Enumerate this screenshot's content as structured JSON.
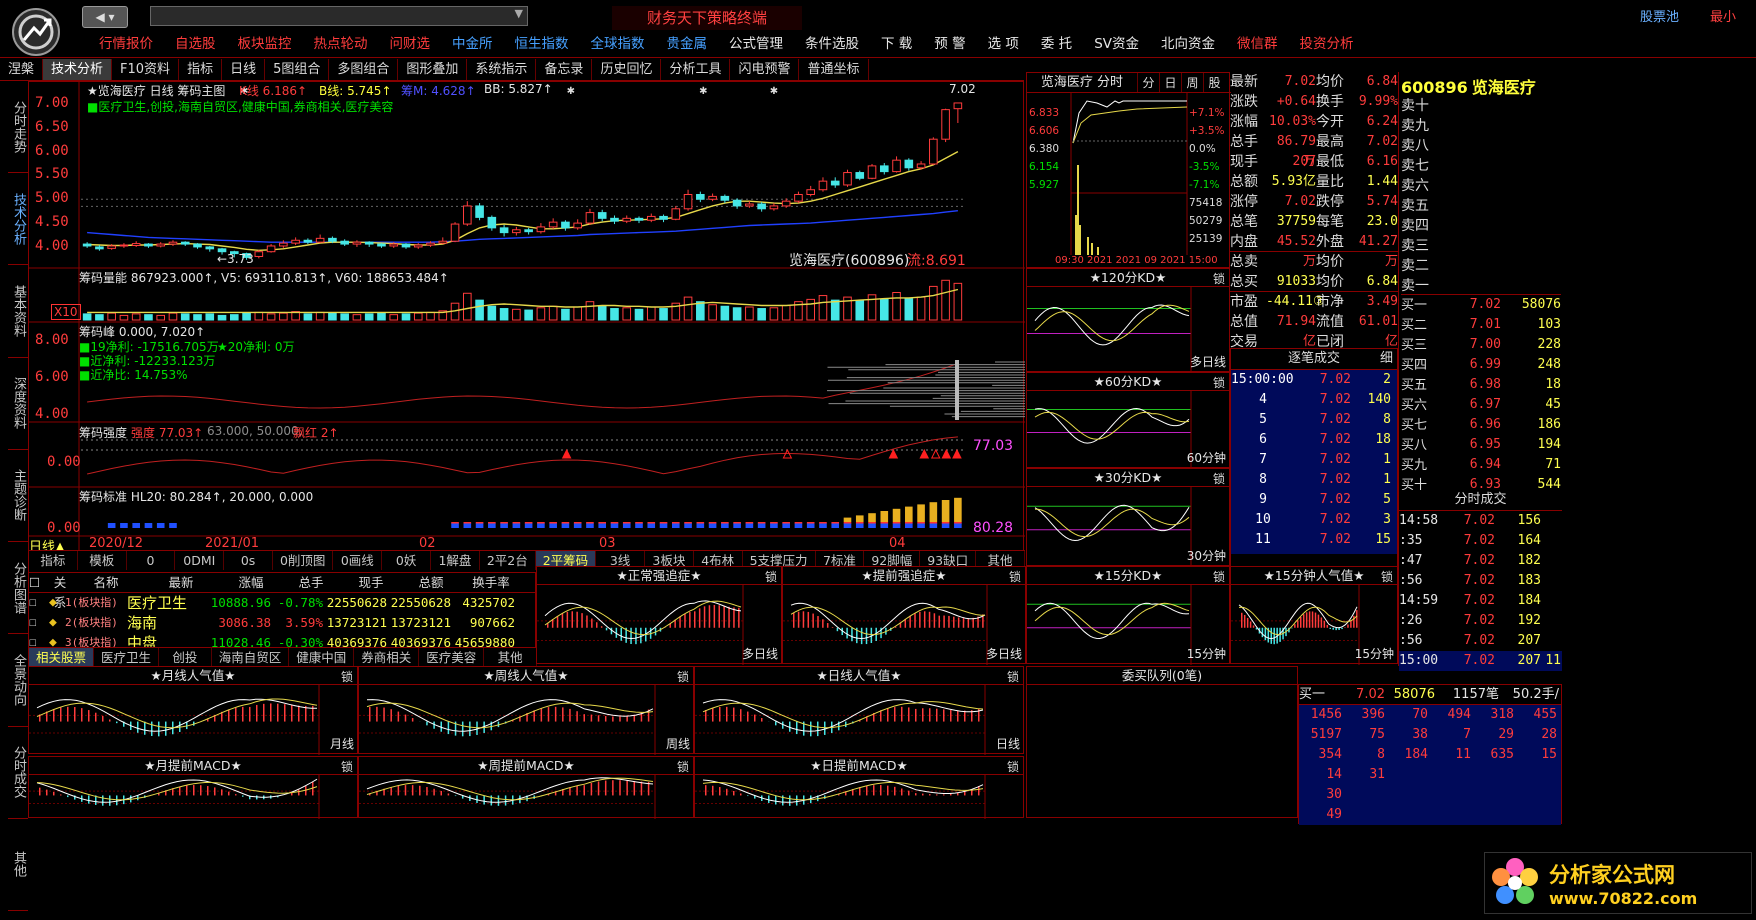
{
  "app": {
    "title": "财务天下策略终端",
    "stock_pool": "股票池",
    "minimize": "最小"
  },
  "menu": [
    {
      "label": "行情报价",
      "color": "#ff3c3c"
    },
    {
      "label": "自选股",
      "color": "#ff3c3c"
    },
    {
      "label": "板块监控",
      "color": "#ff3c3c"
    },
    {
      "label": "热点轮动",
      "color": "#ff3c3c"
    },
    {
      "label": "问财选",
      "color": "#ff3c3c"
    },
    {
      "label": "中金所",
      "color": "#46a0ff"
    },
    {
      "label": "恒生指数",
      "color": "#46a0ff"
    },
    {
      "label": "全球指数",
      "color": "#46a0ff"
    },
    {
      "label": "贵金属",
      "color": "#46a0ff"
    },
    {
      "label": "公式管理",
      "color": "#e6e6e6"
    },
    {
      "label": "条件选股",
      "color": "#e6e6e6"
    },
    {
      "label": "下 载",
      "color": "#e6e6e6"
    },
    {
      "label": "预 警",
      "color": "#e6e6e6"
    },
    {
      "label": "选 项",
      "color": "#e6e6e6"
    },
    {
      "label": "委 托",
      "color": "#e6e6e6"
    },
    {
      "label": "SV资金",
      "color": "#e6e6e6"
    },
    {
      "label": "北向资金",
      "color": "#e6e6e6"
    },
    {
      "label": "微信群",
      "color": "#ff3c3c"
    },
    {
      "label": "投资分析",
      "color": "#ff3c3c"
    }
  ],
  "toolbar": [
    "涅槃",
    "技术分析",
    "F10资料",
    "指标",
    "日线",
    "5图组合",
    "多图组合",
    "图形叠加",
    "系统指示",
    "备忘录",
    "历史回忆",
    "分析工具",
    "闪电预警",
    "普通坐标"
  ],
  "sidetabs": [
    "分时走势",
    "技术分析",
    "基本资料",
    "深度资料",
    "主题诊断",
    "分析图谱",
    "全景动向",
    "分时成交",
    "其他"
  ],
  "main": {
    "header": "★览海医疗 日线 筹码主图",
    "ma_k": "K线 6.186↑",
    "ma_b": "B线: 5.745↑",
    "ma_m": "筹M: 4.628↑",
    "ma_bb": "BB: 5.827↑",
    "concepts": "■医疗卫生,创投,海南自贸区,健康中国,券商相关,医疗美容",
    "y_ticks": [
      "7.00",
      "6.50",
      "6.00",
      "5.50",
      "5.00",
      "4.50",
      "4.00"
    ],
    "hi_label": "7.02",
    "lo_label": "←3.73",
    "name_label": "览海医疗(600896)",
    "liu_label": "流:8.691",
    "vol_header": "筹码量能 867923.000↑, V5: 693110.813↑, V60: 188653.484↑",
    "vol_x10": "X10",
    "peak_header": "筹码峰 0.000, 7.020↑",
    "peak_lines": [
      "■19净利: -17516.705万",
      "★20净利: 0万",
      "■近净利: -12233.123万",
      "■近净比: 14.753%"
    ],
    "peak_ticks": [
      "8.00",
      "6.00",
      "4.00"
    ],
    "str_header": "筹码强度",
    "str_a": "强度 77.03↑",
    "str_b": "63.000, 50.000,",
    "str_c": "飘红 2↑",
    "str_val": "77.03",
    "str_tick": "0.00",
    "std_header": "筹码标准 HL20: 80.284↑, 20.000, 0.000",
    "std_val": "80.28",
    "std_tick": "0.00",
    "date_bar": [
      "日线▲",
      "2020/12",
      "2021/01",
      "02",
      "03",
      "04"
    ],
    "indicator_tabs": [
      "指标",
      "模板",
      "0",
      "0DMI",
      "0s",
      "0削顶图",
      "0画线",
      "0妖",
      "1解盘",
      "2平2台",
      "2平筹码",
      "3线",
      "3板块",
      "4布林",
      "5支撑压力",
      "7标准",
      "92脚幅",
      "93缺口",
      "其他"
    ]
  },
  "sector": {
    "cols": [
      "关系",
      "名称",
      "最新",
      "涨幅",
      "总手",
      "现手",
      "总额",
      "换手率"
    ],
    "rows": [
      {
        "rel": "1(板块指)",
        "name": "医疗卫生",
        "last": "10888.96",
        "chg": "-0.78%",
        "vol": "22550628",
        "cur": "22550628",
        "amt": "4325702",
        "color": "#00e000"
      },
      {
        "rel": "2(板块指)",
        "name": "海南",
        "last": "3086.38",
        "chg": "3.59%",
        "vol": "13723121",
        "cur": "13723121",
        "amt": "907662",
        "color": "#ff3c3c"
      },
      {
        "rel": "3(板块指)",
        "name": "中盘",
        "last": "11028.46",
        "chg": "-0.30%",
        "vol": "40369376",
        "cur": "40369376",
        "amt": "45659880",
        "color": "#00e000"
      }
    ],
    "tabs": [
      "相关股票",
      "医疗卫生",
      "创投",
      "海南自贸区",
      "健康中国",
      "券商相关",
      "医疗美容",
      "其他"
    ]
  },
  "minis": {
    "zhengchang": {
      "title": "★正常强追症★",
      "lock": "锁",
      "foot": "多日线"
    },
    "tiqian": {
      "title": "★提前强追症★",
      "lock": "锁",
      "foot": "多日线"
    },
    "kd15": {
      "title": "★15分KD★",
      "lock": "锁",
      "foot": "15分钟"
    },
    "rq15": {
      "title": "★15分钟人气值★",
      "lock": "锁",
      "foot": "15分钟"
    },
    "month_rq": {
      "title": "★月线人气值★",
      "lock": "锁",
      "foot": "月线"
    },
    "week_rq": {
      "title": "★周线人气值★",
      "lock": "锁",
      "foot": "周线"
    },
    "day_rq": {
      "title": "★日线人气值★",
      "lock": "锁",
      "foot": "日线"
    },
    "month_macd": {
      "title": "★月提前MACD★",
      "lock": "锁"
    },
    "week_macd": {
      "title": "★周提前MACD★",
      "lock": "锁"
    },
    "day_macd": {
      "title": "★日提前MACD★",
      "lock": "锁"
    },
    "kd120": {
      "title": "★120分KD★",
      "lock": "锁",
      "foot": "多日线"
    },
    "kd60": {
      "title": "★60分KD★",
      "lock": "锁",
      "foot": "60分钟"
    },
    "kd30": {
      "title": "★30分KD★",
      "lock": "锁",
      "foot": "30分钟"
    },
    "queue": {
      "title": "委买队列(0笔)"
    }
  },
  "intraday": {
    "header": "览海医疗 分时",
    "tabs": [
      "分",
      "日",
      "周",
      "股"
    ],
    "left_ticks": [
      "6.833",
      "6.606",
      "6.380",
      "6.154",
      "5.927"
    ],
    "right_ticks": [
      "+7.1%",
      "+3.5%",
      "0.0%",
      "-3.5%",
      "-7.1%"
    ],
    "vol_ticks": [
      "75418",
      "50279",
      "25139"
    ],
    "date": "09:30 2021 2021 09 2021 15:00"
  },
  "quote": {
    "rows": [
      [
        "最新",
        "7.02",
        "均价",
        "6.84"
      ],
      [
        "涨跌",
        "+0.64",
        "换手",
        "9.99%"
      ],
      [
        "涨幅",
        "10.03%",
        "今开",
        "6.24"
      ],
      [
        "总手",
        "86.79万",
        "最高",
        "7.02"
      ],
      [
        "现手",
        "207",
        "最低",
        "6.16"
      ],
      [
        "总额",
        "5.93亿",
        "量比",
        "1.44"
      ],
      [
        "涨停",
        "7.02",
        "跌停",
        "5.74"
      ],
      [
        "总笔",
        "37759",
        "每笔",
        "23.0"
      ],
      [
        "内盘",
        "45.52万",
        "外盘",
        "41.27万"
      ],
      [
        "总卖",
        "",
        "均价",
        ""
      ],
      [
        "总买",
        "91033",
        "均价",
        "6.84"
      ],
      [
        "市盈",
        "-44.11③",
        "市净",
        "3.49"
      ],
      [
        "总值",
        "71.94亿",
        "流值",
        "61.01亿"
      ],
      [
        "交易状态",
        "",
        "已闭市",
        ""
      ]
    ]
  },
  "orderbook": {
    "code": "600896",
    "name": "览海医疗",
    "sells": [
      "卖十",
      "卖九",
      "卖八",
      "卖七",
      "卖六",
      "卖五",
      "卖四",
      "卖三",
      "卖二",
      "卖一"
    ],
    "buys": [
      [
        "买一",
        "7.02",
        "58076"
      ],
      [
        "买二",
        "7.01",
        "103"
      ],
      [
        "买三",
        "7.00",
        "228"
      ],
      [
        "买四",
        "6.99",
        "248"
      ],
      [
        "买五",
        "6.98",
        "18"
      ],
      [
        "买六",
        "6.97",
        "45"
      ],
      [
        "买七",
        "6.96",
        "186"
      ],
      [
        "买八",
        "6.95",
        "194"
      ],
      [
        "买九",
        "6.94",
        "71"
      ],
      [
        "买十",
        "6.93",
        "544"
      ]
    ]
  },
  "ticks": {
    "header": "逐笔成交",
    "mode": "细",
    "rows": [
      [
        "15:00:00",
        "7.02",
        "2"
      ],
      [
        "4",
        "7.02",
        "140"
      ],
      [
        "5",
        "7.02",
        "8"
      ],
      [
        "6",
        "7.02",
        "18"
      ],
      [
        "7",
        "7.02",
        "1"
      ],
      [
        "8",
        "7.02",
        "1"
      ],
      [
        "9",
        "7.02",
        "5"
      ],
      [
        "10",
        "7.02",
        "3"
      ],
      [
        "11",
        "7.02",
        "15"
      ]
    ]
  },
  "fenshi": {
    "header": "分时成交",
    "rows": [
      [
        "14:58",
        "7.02",
        "156"
      ],
      [
        ":35",
        "7.02",
        "164"
      ],
      [
        ":47",
        "7.02",
        "182"
      ],
      [
        ":56",
        "7.02",
        "183"
      ],
      [
        "14:59",
        "7.02",
        "184"
      ],
      [
        ":26",
        "7.02",
        "192"
      ],
      [
        ":56",
        "7.02",
        "207"
      ],
      [
        "15:00",
        "7.02",
        "207",
        "11"
      ]
    ]
  },
  "queue_detail": {
    "head": [
      "买一",
      "7.02",
      "58076",
      "1157笔",
      "50.2手/"
    ],
    "rows": [
      [
        "1456",
        "396",
        "70",
        "494",
        "318",
        "455"
      ],
      [
        "5197",
        "75",
        "38",
        "7",
        "29",
        "28"
      ],
      [
        "354",
        "8",
        "184",
        "11",
        "635",
        "15"
      ],
      [
        "14",
        "31",
        "",
        "",
        "",
        ""
      ],
      [
        "30",
        "",
        "",
        "",
        "",
        ""
      ],
      [
        "49",
        "",
        "",
        "",
        "",
        ""
      ]
    ]
  },
  "watermark": {
    "text": "分析家公式网",
    "url": "www.70822.com"
  },
  "chart_data": {
    "type": "candlestick",
    "title": "览海医疗(600896) 日线",
    "y_range": [
      3.6,
      7.25
    ],
    "candles": [
      [
        4.06,
        4.02,
        4.1,
        3.98
      ],
      [
        4.0,
        3.96,
        4.04,
        3.92
      ],
      [
        3.97,
        4.02,
        4.06,
        3.94
      ],
      [
        4.02,
        4.04,
        4.08,
        3.98
      ],
      [
        4.03,
        4.07,
        4.12,
        4.0
      ],
      [
        4.06,
        4.02,
        4.08,
        3.98
      ],
      [
        4.02,
        4.06,
        4.1,
        3.99
      ],
      [
        4.06,
        4.1,
        4.14,
        4.02
      ],
      [
        4.1,
        4.06,
        4.12,
        4.02
      ],
      [
        4.06,
        4.0,
        4.08,
        3.96
      ],
      [
        4.0,
        3.96,
        4.02,
        3.9
      ],
      [
        3.96,
        3.9,
        3.98,
        3.84
      ],
      [
        3.9,
        3.86,
        3.92,
        3.78
      ],
      [
        3.86,
        3.78,
        3.88,
        3.73
      ],
      [
        3.8,
        3.9,
        3.94,
        3.76
      ],
      [
        3.9,
        4.02,
        4.06,
        3.88
      ],
      [
        4.02,
        4.08,
        4.14,
        3.98
      ],
      [
        4.08,
        4.14,
        4.2,
        4.04
      ],
      [
        4.14,
        4.1,
        4.18,
        4.06
      ],
      [
        4.1,
        4.18,
        4.26,
        4.08
      ],
      [
        4.18,
        4.12,
        4.22,
        4.08
      ],
      [
        4.12,
        4.06,
        4.16,
        4.02
      ],
      [
        4.06,
        4.1,
        4.14,
        4.0
      ],
      [
        4.1,
        4.06,
        4.12,
        4.0
      ],
      [
        4.06,
        4.02,
        4.08,
        3.98
      ],
      [
        4.02,
        4.06,
        4.1,
        3.98
      ],
      [
        4.06,
        4.0,
        4.08,
        3.96
      ],
      [
        4.0,
        4.04,
        4.08,
        3.96
      ],
      [
        4.04,
        4.08,
        4.12,
        4.0
      ],
      [
        4.08,
        4.12,
        4.2,
        4.06
      ],
      [
        4.12,
        4.48,
        4.52,
        4.1
      ],
      [
        4.48,
        4.86,
        4.96,
        4.44
      ],
      [
        4.86,
        4.62,
        4.92,
        4.56
      ],
      [
        4.62,
        4.4,
        4.66,
        4.34
      ],
      [
        4.4,
        4.3,
        4.46,
        4.22
      ],
      [
        4.3,
        4.36,
        4.42,
        4.24
      ],
      [
        4.36,
        4.32,
        4.4,
        4.26
      ],
      [
        4.32,
        4.42,
        4.5,
        4.28
      ],
      [
        4.42,
        4.52,
        4.6,
        4.38
      ],
      [
        4.52,
        4.4,
        4.56,
        4.34
      ],
      [
        4.4,
        4.5,
        4.58,
        4.36
      ],
      [
        4.5,
        4.72,
        4.8,
        4.46
      ],
      [
        4.72,
        4.6,
        4.78,
        4.54
      ],
      [
        4.6,
        4.54,
        4.66,
        4.48
      ],
      [
        4.54,
        4.6,
        4.66,
        4.5
      ],
      [
        4.6,
        4.56,
        4.64,
        4.5
      ],
      [
        4.56,
        4.64,
        4.7,
        4.52
      ],
      [
        4.64,
        4.58,
        4.68,
        4.52
      ],
      [
        4.58,
        4.8,
        4.86,
        4.56
      ],
      [
        4.8,
        5.1,
        5.2,
        4.76
      ],
      [
        5.1,
        5.0,
        5.16,
        4.94
      ],
      [
        5.0,
        5.06,
        5.12,
        4.96
      ],
      [
        5.06,
        4.98,
        5.1,
        4.92
      ],
      [
        4.98,
        4.86,
        5.02,
        4.8
      ],
      [
        4.86,
        4.9,
        4.96,
        4.82
      ],
      [
        4.9,
        4.8,
        4.94,
        4.74
      ],
      [
        4.8,
        4.86,
        4.92,
        4.76
      ],
      [
        4.86,
        4.96,
        5.02,
        4.82
      ],
      [
        4.96,
        5.1,
        5.16,
        4.92
      ],
      [
        5.1,
        5.2,
        5.28,
        5.06
      ],
      [
        5.2,
        5.38,
        5.46,
        5.16
      ],
      [
        5.38,
        5.3,
        5.46,
        5.24
      ],
      [
        5.3,
        5.56,
        5.62,
        5.26
      ],
      [
        5.56,
        5.44,
        5.6,
        5.4
      ],
      [
        5.44,
        5.7,
        5.74,
        5.42
      ],
      [
        5.7,
        5.58,
        5.76,
        5.52
      ],
      [
        5.58,
        5.82,
        5.9,
        5.56
      ],
      [
        5.82,
        5.66,
        5.86,
        5.6
      ],
      [
        5.66,
        5.74,
        5.8,
        5.62
      ],
      [
        5.74,
        6.26,
        6.3,
        5.72
      ],
      [
        6.26,
        6.88,
        6.9,
        6.2
      ],
      [
        6.9,
        7.02,
        7.02,
        6.6
      ]
    ],
    "ma_fast": [
      4.05,
      4.04,
      4.03,
      4.03,
      4.04,
      4.04,
      4.05,
      4.06,
      4.07,
      4.06,
      4.05,
      4.02,
      3.99,
      3.95,
      3.93,
      3.94,
      3.96,
      4.0,
      4.04,
      4.08,
      4.1,
      4.1,
      4.1,
      4.09,
      4.08,
      4.07,
      4.05,
      4.04,
      4.04,
      4.06,
      4.14,
      4.28,
      4.4,
      4.46,
      4.48,
      4.46,
      4.42,
      4.38,
      4.38,
      4.4,
      4.42,
      4.48,
      4.52,
      4.55,
      4.56,
      4.57,
      4.58,
      4.59,
      4.62,
      4.7,
      4.78,
      4.86,
      4.92,
      4.96,
      4.96,
      4.94,
      4.92,
      4.91,
      4.92,
      4.96,
      5.02,
      5.1,
      5.18,
      5.26,
      5.34,
      5.42,
      5.5,
      5.58,
      5.64,
      5.72,
      5.86,
      6.0
    ],
    "ma_slow": [
      4.3,
      4.28,
      4.26,
      4.24,
      4.22,
      4.2,
      4.19,
      4.18,
      4.17,
      4.16,
      4.15,
      4.14,
      4.13,
      4.12,
      4.11,
      4.1,
      4.1,
      4.1,
      4.1,
      4.1,
      4.1,
      4.1,
      4.1,
      4.1,
      4.1,
      4.1,
      4.1,
      4.1,
      4.1,
      4.11,
      4.12,
      4.14,
      4.16,
      4.17,
      4.18,
      4.19,
      4.2,
      4.21,
      4.22,
      4.23,
      4.24,
      4.26,
      4.27,
      4.28,
      4.29,
      4.3,
      4.31,
      4.32,
      4.33,
      4.35,
      4.37,
      4.39,
      4.41,
      4.43,
      4.45,
      4.46,
      4.47,
      4.48,
      4.49,
      4.5,
      4.52,
      4.54,
      4.56,
      4.58,
      4.6,
      4.62,
      4.64,
      4.66,
      4.68,
      4.7,
      4.73,
      4.76
    ],
    "volume": [
      8,
      7,
      9,
      6,
      8,
      7,
      6,
      9,
      8,
      7,
      8,
      6,
      7,
      9,
      10,
      8,
      9,
      11,
      8,
      10,
      9,
      8,
      7,
      8,
      9,
      7,
      8,
      9,
      10,
      12,
      22,
      35,
      26,
      18,
      15,
      14,
      13,
      16,
      18,
      14,
      17,
      24,
      19,
      15,
      16,
      14,
      17,
      15,
      22,
      30,
      24,
      20,
      18,
      16,
      17,
      15,
      16,
      19,
      24,
      27,
      32,
      26,
      30,
      25,
      33,
      27,
      36,
      28,
      30,
      44,
      52,
      48
    ],
    "volume_ma": [
      10,
      10,
      10,
      10,
      10,
      10,
      10,
      10,
      10,
      10,
      10,
      10,
      10,
      10,
      10,
      10,
      10,
      10,
      10,
      10,
      10,
      10,
      10,
      10,
      10,
      10,
      10,
      10,
      10,
      10,
      12,
      15,
      18,
      20,
      21,
      20,
      19,
      18,
      18,
      17,
      17,
      18,
      19,
      19,
      18,
      18,
      17,
      17,
      18,
      20,
      22,
      23,
      22,
      21,
      20,
      19,
      19,
      19,
      20,
      21,
      23,
      24,
      25,
      26,
      27,
      28,
      29,
      29,
      30,
      32,
      36,
      40
    ]
  }
}
